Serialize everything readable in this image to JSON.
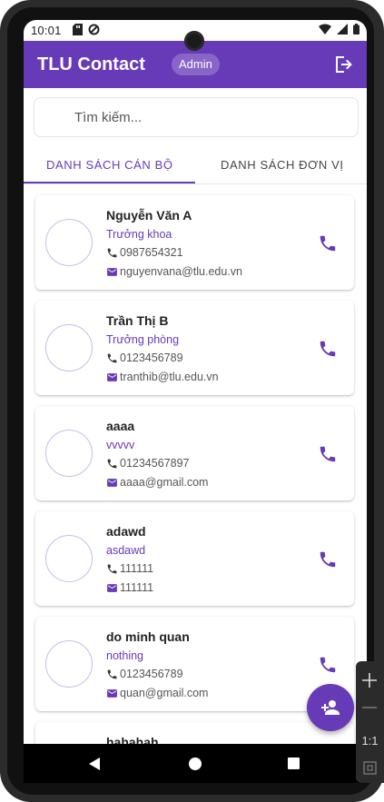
{
  "status_bar": {
    "time": "10:01"
  },
  "app": {
    "title": "TLU Contact",
    "role_badge": "Admin"
  },
  "search": {
    "placeholder": "Tìm kiếm..."
  },
  "tabs": [
    {
      "label": "DANH SÁCH CÁN BỘ",
      "active": true
    },
    {
      "label": "DANH SÁCH ĐƠN VỊ",
      "active": false
    }
  ],
  "contacts": [
    {
      "name": "Nguyễn Văn A",
      "position": "Trưởng khoa",
      "phone": "0987654321",
      "email": "nguyenvana@tlu.edu.vn"
    },
    {
      "name": "Trần Thị B",
      "position": "Trưởng phòng",
      "phone": "0123456789",
      "email": "tranthib@tlu.edu.vn"
    },
    {
      "name": "aaaa",
      "position": "vvvvv",
      "phone": "01234567897",
      "email": "aaaa@gmail.com"
    },
    {
      "name": "adawd",
      "position": "asdawd",
      "phone": "111111",
      "email": "111111"
    },
    {
      "name": "do minh quan",
      "position": "nothing",
      "phone": "0123456789",
      "email": "quan@gmail.com"
    },
    {
      "name": "hahahah",
      "position": "",
      "phone": "",
      "email": ""
    }
  ],
  "emulator_toolbar": {
    "zoom_label": "1:1"
  },
  "colors": {
    "primary": "#673ab7",
    "card_bg": "#ffffff",
    "text": "#222222"
  }
}
